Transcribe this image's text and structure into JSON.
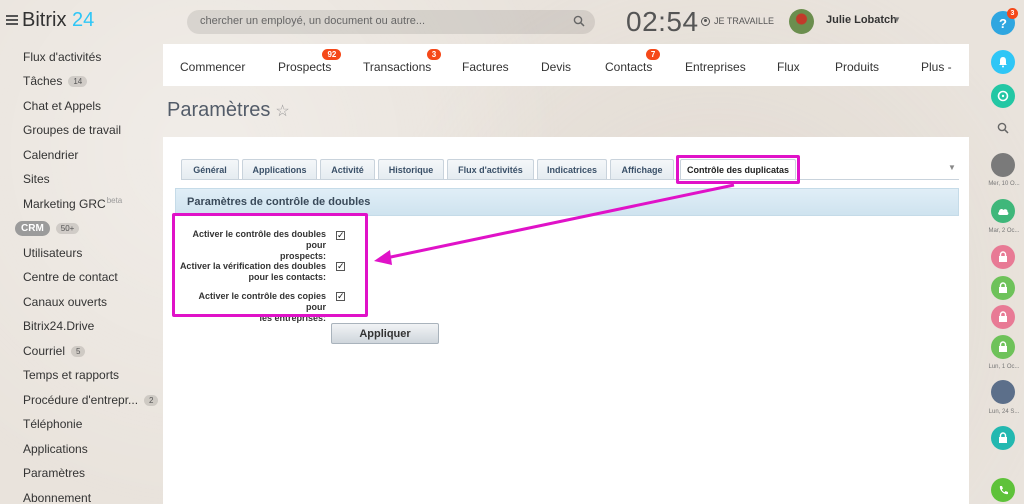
{
  "app": {
    "logo_text": "Bitrix",
    "logo_num": "24"
  },
  "search": {
    "placeholder": "chercher un employé, un document ou autre..."
  },
  "clock": {
    "time": "02:54",
    "status": "JE TRAVAILLE"
  },
  "user": {
    "name": "Julie Lobatch"
  },
  "sidebar": {
    "items": [
      {
        "label": "Flux d'activités"
      },
      {
        "label": "Tâches",
        "count": "14"
      },
      {
        "label": "Chat et Appels"
      },
      {
        "label": "Groupes de travail"
      },
      {
        "label": "Calendrier"
      },
      {
        "label": "Sites"
      },
      {
        "label": "Marketing GRC",
        "tag": "beta"
      },
      {
        "label": "CRM",
        "count": "50+"
      },
      {
        "label": "Utilisateurs"
      },
      {
        "label": "Centre de contact"
      },
      {
        "label": "Canaux ouverts"
      },
      {
        "label": "Bitrix24.Drive"
      },
      {
        "label": "Courriel",
        "count": "5"
      },
      {
        "label": "Temps et rapports"
      },
      {
        "label": "Procédure d'entrepr...",
        "count": "2"
      },
      {
        "label": "Téléphonie"
      },
      {
        "label": "Applications"
      },
      {
        "label": "Paramètres"
      },
      {
        "label": "Abonnement"
      }
    ]
  },
  "rightbar": {
    "help_badge": "3",
    "dates": [
      "Mer, 10 O...",
      "Mar, 2 Oc...",
      "Lun, 1 Oc...",
      "Lun, 24 S..."
    ]
  },
  "topnav": {
    "items": [
      {
        "label": "Commencer"
      },
      {
        "label": "Prospects",
        "badge": "92"
      },
      {
        "label": "Transactions",
        "badge": "3"
      },
      {
        "label": "Factures"
      },
      {
        "label": "Devis"
      },
      {
        "label": "Contacts",
        "badge": "7"
      },
      {
        "label": "Entreprises"
      },
      {
        "label": "Flux"
      },
      {
        "label": "Produits"
      },
      {
        "label": "Plus -"
      }
    ]
  },
  "page": {
    "title": "Paramètres"
  },
  "tabs": [
    {
      "label": "Général"
    },
    {
      "label": "Applications"
    },
    {
      "label": "Activité"
    },
    {
      "label": "Historique"
    },
    {
      "label": "Flux d'activités"
    },
    {
      "label": "Indicatrices"
    },
    {
      "label": "Affichage"
    },
    {
      "label": "Contrôle des duplicatas",
      "active": true
    }
  ],
  "section": {
    "title": "Paramètres de contrôle de doubles"
  },
  "options": [
    {
      "label_line1": "Activer le contrôle des doubles pour",
      "label_line2": "prospects:",
      "checked": true
    },
    {
      "label_line1": "Activer la vérification des doubles",
      "label_line2": "pour les contacts:",
      "checked": true
    },
    {
      "label_line1": "Activer le contrôle des copies pour",
      "label_line2": "les entreprises:",
      "checked": true
    }
  ],
  "apply_label": "Appliquer",
  "colors": {
    "accent": "#2fc6f6",
    "annotation": "#e012c8",
    "badge": "#f54819"
  }
}
